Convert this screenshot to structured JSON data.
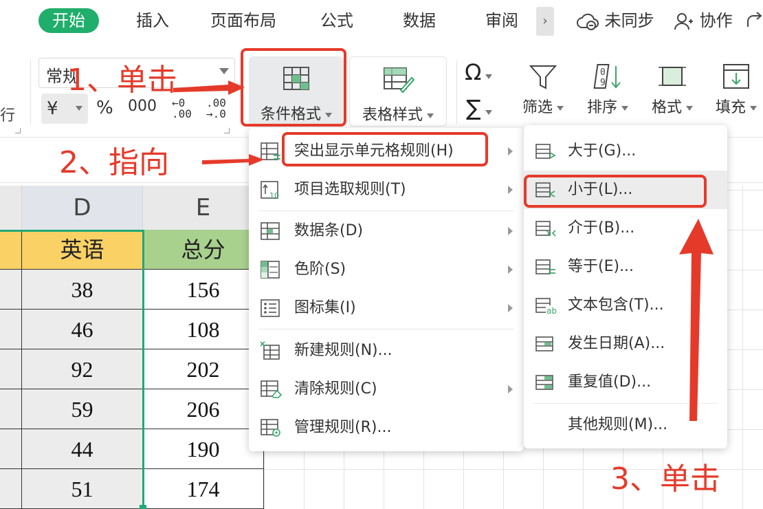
{
  "tabs": [
    {
      "label": "开始",
      "active": true
    },
    {
      "label": "插入"
    },
    {
      "label": "页面布局"
    },
    {
      "label": "公式"
    },
    {
      "label": "数据"
    },
    {
      "label": "审阅"
    }
  ],
  "tab_more": "›",
  "sync_label": "未同步",
  "collab_label": "协作",
  "ribbon": {
    "row_label": "行",
    "number_format": "常规",
    "currency_symbol": "¥",
    "percent_symbol": "%",
    "comma_symbol": "000",
    "inc_decimal_top": "←0",
    "inc_decimal_bottom": ".00",
    "dec_decimal_top": ".00",
    "dec_decimal_bottom": "→.0",
    "conditional_format": "条件格式",
    "table_style": "表格样式",
    "symbol_glyph": "Ω",
    "sum_glyph": "∑",
    "filter": "筛选",
    "sort": "排序",
    "format": "格式",
    "fill": "填充"
  },
  "sheet": {
    "columns": [
      "D",
      "E"
    ],
    "headers": [
      "英语",
      "总分"
    ],
    "rows": [
      [
        "38",
        "156"
      ],
      [
        "46",
        "108"
      ],
      [
        "92",
        "202"
      ],
      [
        "59",
        "206"
      ],
      [
        "44",
        "190"
      ],
      [
        "51",
        "174"
      ]
    ]
  },
  "menu": {
    "items": [
      {
        "label": "突出显示单元格规则(H)",
        "submenu": true
      },
      {
        "label": "项目选取规则(T)",
        "submenu": true
      },
      {
        "label": "数据条(D)",
        "submenu": true
      },
      {
        "label": "色阶(S)",
        "submenu": true
      },
      {
        "label": "图标集(I)",
        "submenu": true
      },
      {
        "label": "新建规则(N)..."
      },
      {
        "label": "清除规则(C)",
        "submenu": true
      },
      {
        "label": "管理规则(R)..."
      }
    ]
  },
  "submenu": {
    "items": [
      {
        "label": "大于(G)..."
      },
      {
        "label": "小于(L)..."
      },
      {
        "label": "介于(B)..."
      },
      {
        "label": "等于(E)..."
      },
      {
        "label": "文本包含(T)..."
      },
      {
        "label": "发生日期(A)..."
      },
      {
        "label": "重复值(D)..."
      },
      {
        "label": "其他规则(M)..."
      }
    ]
  },
  "annotations": {
    "step1": "1、单击",
    "step2": "2、指向",
    "step3": "3、单击"
  },
  "colors": {
    "accent": "#1fae6b",
    "annotation": "#e53a2a",
    "header_english_bg": "#fad165",
    "header_total_bg": "#a9d18e"
  }
}
